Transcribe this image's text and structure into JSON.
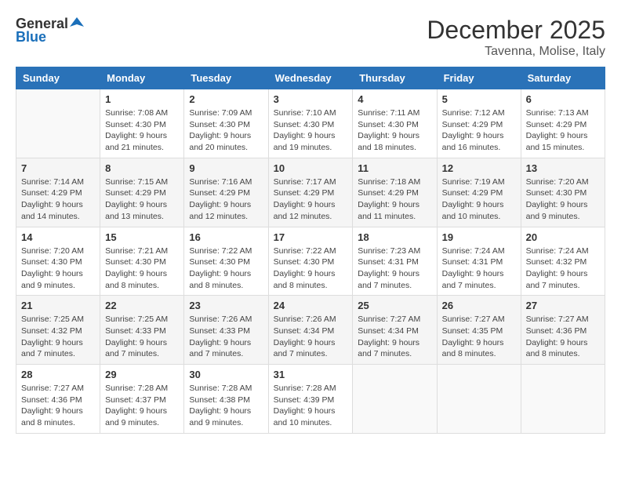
{
  "logo": {
    "general": "General",
    "blue": "Blue"
  },
  "title": "December 2025",
  "subtitle": "Tavenna, Molise, Italy",
  "headers": [
    "Sunday",
    "Monday",
    "Tuesday",
    "Wednesday",
    "Thursday",
    "Friday",
    "Saturday"
  ],
  "weeks": [
    [
      {
        "num": "",
        "info": ""
      },
      {
        "num": "1",
        "info": "Sunrise: 7:08 AM\nSunset: 4:30 PM\nDaylight: 9 hours\nand 21 minutes."
      },
      {
        "num": "2",
        "info": "Sunrise: 7:09 AM\nSunset: 4:30 PM\nDaylight: 9 hours\nand 20 minutes."
      },
      {
        "num": "3",
        "info": "Sunrise: 7:10 AM\nSunset: 4:30 PM\nDaylight: 9 hours\nand 19 minutes."
      },
      {
        "num": "4",
        "info": "Sunrise: 7:11 AM\nSunset: 4:30 PM\nDaylight: 9 hours\nand 18 minutes."
      },
      {
        "num": "5",
        "info": "Sunrise: 7:12 AM\nSunset: 4:29 PM\nDaylight: 9 hours\nand 16 minutes."
      },
      {
        "num": "6",
        "info": "Sunrise: 7:13 AM\nSunset: 4:29 PM\nDaylight: 9 hours\nand 15 minutes."
      }
    ],
    [
      {
        "num": "7",
        "info": "Sunrise: 7:14 AM\nSunset: 4:29 PM\nDaylight: 9 hours\nand 14 minutes."
      },
      {
        "num": "8",
        "info": "Sunrise: 7:15 AM\nSunset: 4:29 PM\nDaylight: 9 hours\nand 13 minutes."
      },
      {
        "num": "9",
        "info": "Sunrise: 7:16 AM\nSunset: 4:29 PM\nDaylight: 9 hours\nand 12 minutes."
      },
      {
        "num": "10",
        "info": "Sunrise: 7:17 AM\nSunset: 4:29 PM\nDaylight: 9 hours\nand 12 minutes."
      },
      {
        "num": "11",
        "info": "Sunrise: 7:18 AM\nSunset: 4:29 PM\nDaylight: 9 hours\nand 11 minutes."
      },
      {
        "num": "12",
        "info": "Sunrise: 7:19 AM\nSunset: 4:29 PM\nDaylight: 9 hours\nand 10 minutes."
      },
      {
        "num": "13",
        "info": "Sunrise: 7:20 AM\nSunset: 4:30 PM\nDaylight: 9 hours\nand 9 minutes."
      }
    ],
    [
      {
        "num": "14",
        "info": "Sunrise: 7:20 AM\nSunset: 4:30 PM\nDaylight: 9 hours\nand 9 minutes."
      },
      {
        "num": "15",
        "info": "Sunrise: 7:21 AM\nSunset: 4:30 PM\nDaylight: 9 hours\nand 8 minutes."
      },
      {
        "num": "16",
        "info": "Sunrise: 7:22 AM\nSunset: 4:30 PM\nDaylight: 9 hours\nand 8 minutes."
      },
      {
        "num": "17",
        "info": "Sunrise: 7:22 AM\nSunset: 4:30 PM\nDaylight: 9 hours\nand 8 minutes."
      },
      {
        "num": "18",
        "info": "Sunrise: 7:23 AM\nSunset: 4:31 PM\nDaylight: 9 hours\nand 7 minutes."
      },
      {
        "num": "19",
        "info": "Sunrise: 7:24 AM\nSunset: 4:31 PM\nDaylight: 9 hours\nand 7 minutes."
      },
      {
        "num": "20",
        "info": "Sunrise: 7:24 AM\nSunset: 4:32 PM\nDaylight: 9 hours\nand 7 minutes."
      }
    ],
    [
      {
        "num": "21",
        "info": "Sunrise: 7:25 AM\nSunset: 4:32 PM\nDaylight: 9 hours\nand 7 minutes."
      },
      {
        "num": "22",
        "info": "Sunrise: 7:25 AM\nSunset: 4:33 PM\nDaylight: 9 hours\nand 7 minutes."
      },
      {
        "num": "23",
        "info": "Sunrise: 7:26 AM\nSunset: 4:33 PM\nDaylight: 9 hours\nand 7 minutes."
      },
      {
        "num": "24",
        "info": "Sunrise: 7:26 AM\nSunset: 4:34 PM\nDaylight: 9 hours\nand 7 minutes."
      },
      {
        "num": "25",
        "info": "Sunrise: 7:27 AM\nSunset: 4:34 PM\nDaylight: 9 hours\nand 7 minutes."
      },
      {
        "num": "26",
        "info": "Sunrise: 7:27 AM\nSunset: 4:35 PM\nDaylight: 9 hours\nand 8 minutes."
      },
      {
        "num": "27",
        "info": "Sunrise: 7:27 AM\nSunset: 4:36 PM\nDaylight: 9 hours\nand 8 minutes."
      }
    ],
    [
      {
        "num": "28",
        "info": "Sunrise: 7:27 AM\nSunset: 4:36 PM\nDaylight: 9 hours\nand 8 minutes."
      },
      {
        "num": "29",
        "info": "Sunrise: 7:28 AM\nSunset: 4:37 PM\nDaylight: 9 hours\nand 9 minutes."
      },
      {
        "num": "30",
        "info": "Sunrise: 7:28 AM\nSunset: 4:38 PM\nDaylight: 9 hours\nand 9 minutes."
      },
      {
        "num": "31",
        "info": "Sunrise: 7:28 AM\nSunset: 4:39 PM\nDaylight: 9 hours\nand 10 minutes."
      },
      {
        "num": "",
        "info": ""
      },
      {
        "num": "",
        "info": ""
      },
      {
        "num": "",
        "info": ""
      }
    ]
  ]
}
